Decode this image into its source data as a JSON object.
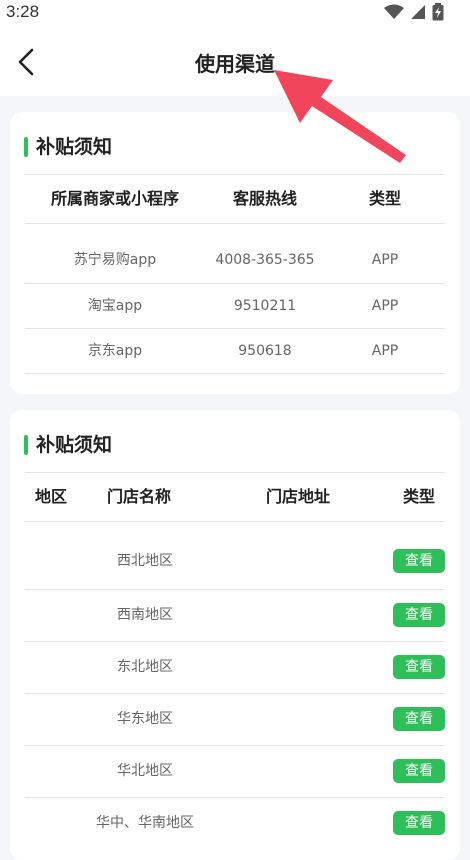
{
  "status_bar": {
    "time": "3:28",
    "icons": [
      "wifi-icon",
      "signal-icon",
      "battery-icon"
    ]
  },
  "header": {
    "title": "使用渠道",
    "back_icon": "back-arrow-icon"
  },
  "card1": {
    "title": "补贴须知",
    "columns": [
      "所属商家或小程序",
      "客服热线",
      "类型"
    ],
    "rows": [
      {
        "name": "苏宁易购app",
        "phone": "4008-365-365",
        "type": "APP"
      },
      {
        "name": "淘宝app",
        "phone": "9510211",
        "type": "APP"
      },
      {
        "name": "京东app",
        "phone": "950618",
        "type": "APP"
      }
    ]
  },
  "card2": {
    "title": "补贴须知",
    "columns": [
      "地区",
      "门店名称",
      "门店地址",
      "类型"
    ],
    "rows": [
      {
        "region": "西北地区",
        "action": "查看"
      },
      {
        "region": "西南地区",
        "action": "查看"
      },
      {
        "region": "东北地区",
        "action": "查看"
      },
      {
        "region": "华东地区",
        "action": "查看"
      },
      {
        "region": "华北地区",
        "action": "查看"
      },
      {
        "region": "华中、华南地区",
        "action": "查看"
      }
    ]
  },
  "colors": {
    "accent": "#2fbf5a",
    "annotation_arrow": "#f0455b",
    "background": "#f5f6f8"
  }
}
